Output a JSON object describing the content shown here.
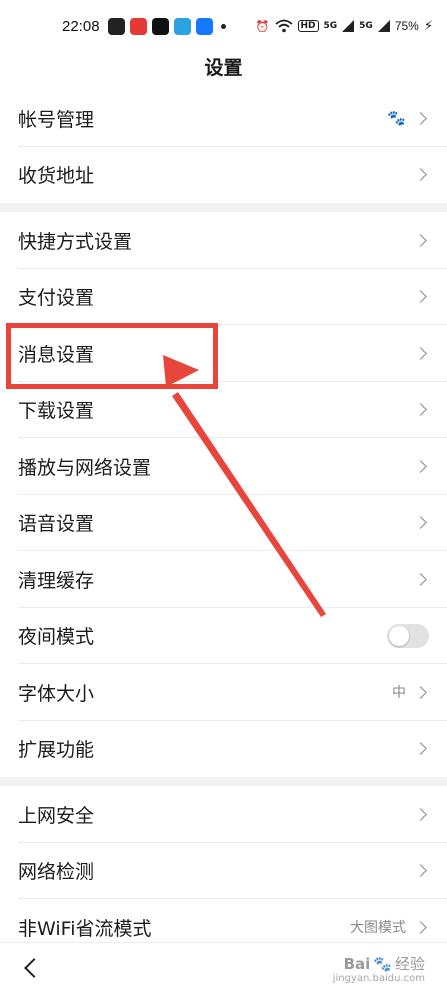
{
  "status_bar": {
    "time": "22:08",
    "app_icons": [
      {
        "name": "app-1-icon",
        "color": "#222222"
      },
      {
        "name": "app-2-icon",
        "color": "#e53935"
      },
      {
        "name": "tiktok-icon",
        "color": "#111111"
      },
      {
        "name": "telegram-icon",
        "color": "#2aa3e0"
      },
      {
        "name": "alipay-icon",
        "color": "#1677ff"
      }
    ],
    "signal_1": "5G",
    "signal_2": "5G",
    "hd_badge": "HD",
    "battery": "75%"
  },
  "page": {
    "title": "设置"
  },
  "groups": [
    [
      {
        "id": "account",
        "label": "帐号管理",
        "right_icon": "paw-icon"
      },
      {
        "id": "address",
        "label": "收货地址"
      }
    ],
    [
      {
        "id": "shortcut",
        "label": "快捷方式设置"
      },
      {
        "id": "payment",
        "label": "支付设置"
      },
      {
        "id": "message",
        "label": "消息设置"
      },
      {
        "id": "download",
        "label": "下载设置"
      },
      {
        "id": "playback",
        "label": "播放与网络设置"
      },
      {
        "id": "voice",
        "label": "语音设置"
      },
      {
        "id": "cache",
        "label": "清理缓存"
      },
      {
        "id": "night",
        "label": "夜间模式",
        "toggle": false
      },
      {
        "id": "font",
        "label": "字体大小",
        "value": "中"
      },
      {
        "id": "extension",
        "label": "扩展功能"
      }
    ],
    [
      {
        "id": "security",
        "label": "上网安全"
      },
      {
        "id": "network-check",
        "label": "网络检测"
      },
      {
        "id": "data-saver",
        "label": "非WiFi省流模式",
        "value": "大图模式"
      }
    ]
  ],
  "watermark": {
    "text": "Bai",
    "paw": "🐾",
    "suffix": "经验",
    "url": "jingyan.baidu.com"
  },
  "annotation_color": "#e8453c"
}
